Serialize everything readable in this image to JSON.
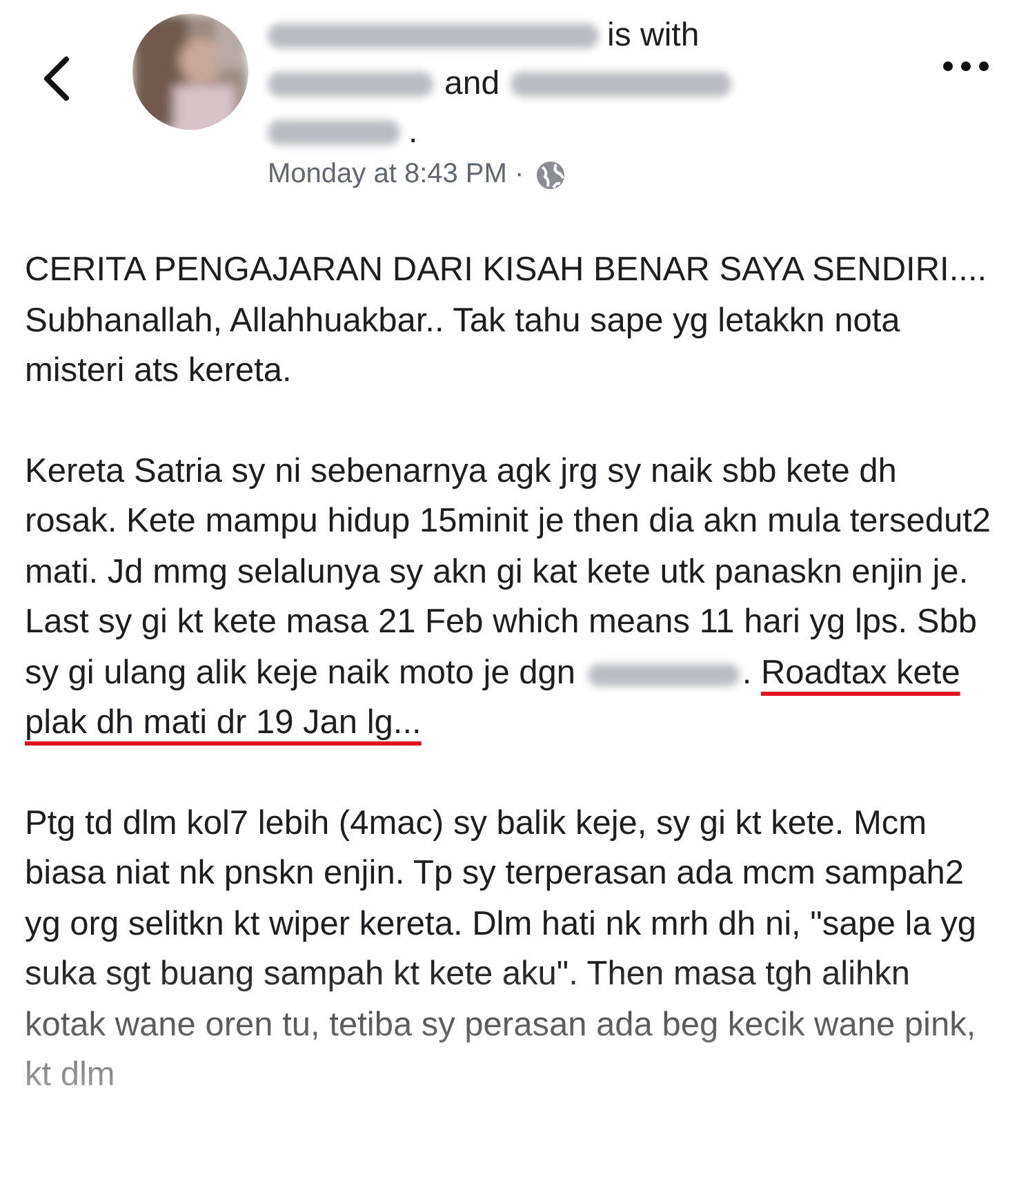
{
  "header": {
    "lines": [
      [
        {
          "kind": "blurred"
        },
        {
          "kind": "text",
          "text": "is with"
        }
      ],
      [
        {
          "kind": "blurred"
        },
        {
          "kind": "text",
          "text": "and"
        },
        {
          "kind": "blurred"
        }
      ],
      [
        {
          "kind": "blurred"
        },
        {
          "kind": "text",
          "text": "."
        }
      ]
    ],
    "time": "Monday at 8:43 PM ·"
  },
  "post": {
    "paragraphs": [
      [
        {
          "kind": "text",
          "text": "CERITA PENGAJARAN DARI KISAH BENAR SAYA SENDIRI...."
        },
        {
          "kind": "break"
        },
        {
          "kind": "text",
          "text": "Subhanallah, Allahhuakbar.. Tak tahu sape yg letakkn nota misteri ats kereta."
        }
      ],
      [
        {
          "kind": "text",
          "text": "Kereta Satria sy ni sebenarnya agk jrg sy naik sbb kete dh rosak. Kete mampu hidup 15minit je then dia akn mula tersedut2 mati. Jd mmg selalunya sy akn gi kat kete utk panaskn enjin je. Last sy gi kt kete masa 21 Feb which means 11 hari yg lps. Sbb sy gi ulang alik keje naik moto je dgn "
        },
        {
          "kind": "blurred"
        },
        {
          "kind": "text",
          "text": ". "
        },
        {
          "kind": "underlined",
          "text": "Roadtax kete plak dh mati dr 19 Jan lg..."
        }
      ],
      [
        {
          "kind": "text",
          "text": "Ptg td dlm kol7 lebih (4mac) sy balik keje, sy gi kt kete. Mcm biasa niat nk pnskn enjin. Tp sy terperasan ada mcm sampah2 yg org selitkn kt wiper kereta. Dlm hati nk mrh dh ni, \"sape la yg suka sgt buang sampah kt kete aku\". Then masa tgh alihkn kotak wane oren tu, tetiba sy perasan ada beg kecik wane pink, kt dlm"
        }
      ]
    ]
  }
}
